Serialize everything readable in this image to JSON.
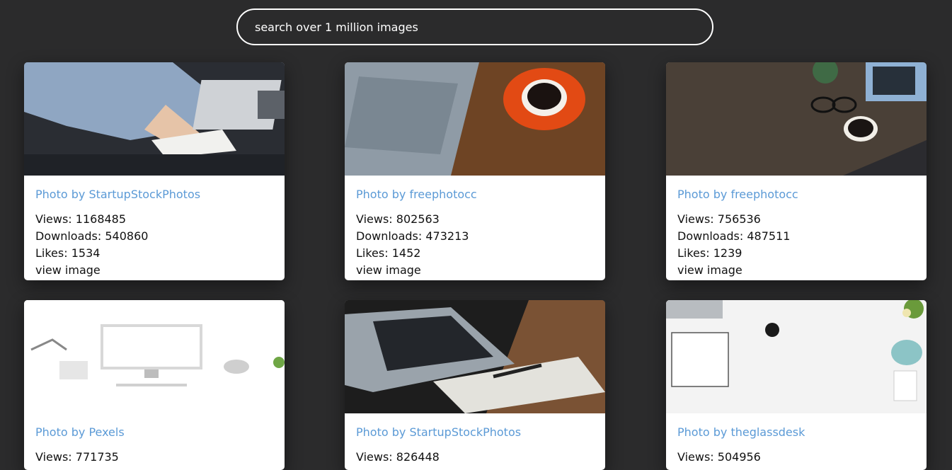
{
  "search": {
    "placeholder": "search over 1 million images"
  },
  "cards": [
    {
      "photographer": "Photo by StartupStockPhotos",
      "views": "Views: 1168485",
      "downloads": "Downloads: 540860",
      "likes": "Likes: 1534",
      "link": "view image",
      "image": "person-writing-at-laptop-photo"
    },
    {
      "photographer": "Photo by freephotocc",
      "views": "Views: 802563",
      "downloads": "Downloads: 473213",
      "likes": "Likes: 1452",
      "link": "view image",
      "image": "laptop-and-coffee-on-wood-photo"
    },
    {
      "photographer": "Photo by freephotocc",
      "views": "Views: 756536",
      "downloads": "Downloads: 487511",
      "likes": "Likes: 1239",
      "link": "view image",
      "image": "desk-with-glasses-and-coffee-photo"
    },
    {
      "photographer": "Photo by Pexels",
      "views": "Views: 771735",
      "image": "imac-on-white-desk-photo"
    },
    {
      "photographer": "Photo by StartupStockPhotos",
      "views": "Views: 826448",
      "image": "laptop-and-notebook-photo"
    },
    {
      "photographer": "Photo by theglassdesk",
      "views": "Views: 504956",
      "image": "white-desk-flatlay-photo"
    }
  ]
}
